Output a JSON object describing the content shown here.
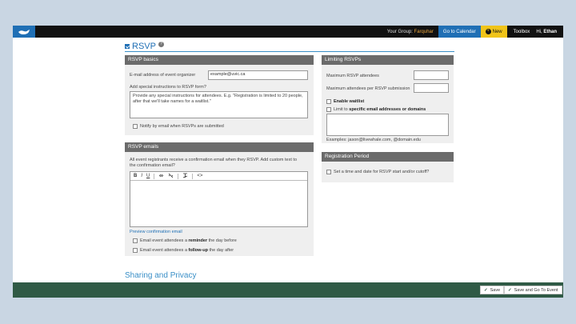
{
  "topbar": {
    "group_prefix": "Your Group:",
    "group_name": "Farquhar",
    "go_to_calendar": "Go to Calendar",
    "new_label": "New",
    "toolbox": "Toolbox",
    "greeting_prefix": "Hi,",
    "user_name": "Ethan"
  },
  "header": {
    "title": "RSVP",
    "help": "?"
  },
  "rsvp_basics": {
    "title": "RSVP basics",
    "email_label": "E-mail address of event organizer",
    "email_value": "example@uvic.ca",
    "instructions_label": "Add special instructions to RSVP form?",
    "instructions_text": "Provide any special instructions for attendees. E.g. \"Registration is limited to 20 people, after that we'll take names for a waitlist.\"",
    "notify_label": "Notify by email when RSVPs are submitted"
  },
  "rsvp_emails": {
    "title": "RSVP emails",
    "description": "All event registrants receive a confirmation email when they RSVP. Add custom text to the confirmation email?",
    "toolbar": {
      "bold": "B",
      "italic": "I",
      "underline": "U",
      "source": "<>"
    },
    "preview_link": "Preview confirmation email",
    "reminder_prefix": "Email event attendees a",
    "reminder_bold": "reminder",
    "reminder_suffix": "the day before",
    "followup_prefix": "Email event attendees a",
    "followup_bold": "follow-up",
    "followup_suffix": "the day after"
  },
  "limiting": {
    "title": "Limiting RSVPs",
    "max_attendees_label": "Maximum RSVP attendees",
    "max_per_submission_label": "Maximum attendees per RSVP submission",
    "enable_waitlist": "Enable waitlist",
    "limit_prefix": "Limit to",
    "limit_bold": "specific email addresses or domains",
    "examples": "Examples: jason@livewhale.com, @domain.edu"
  },
  "registration": {
    "title": "Registration Period",
    "set_time_label": "Set a time and date for RSVP start and/or cutoff?"
  },
  "sharing_title": "Sharing and Privacy",
  "footer": {
    "save": "Save",
    "save_go": "Save and Go To Event"
  },
  "colors": {
    "topbar": "#111111",
    "accent_blue": "#1f6fb5",
    "new_yellow": "#f0c419",
    "panel_header": "#6b6b6b",
    "footer_green": "#2f5a45"
  }
}
